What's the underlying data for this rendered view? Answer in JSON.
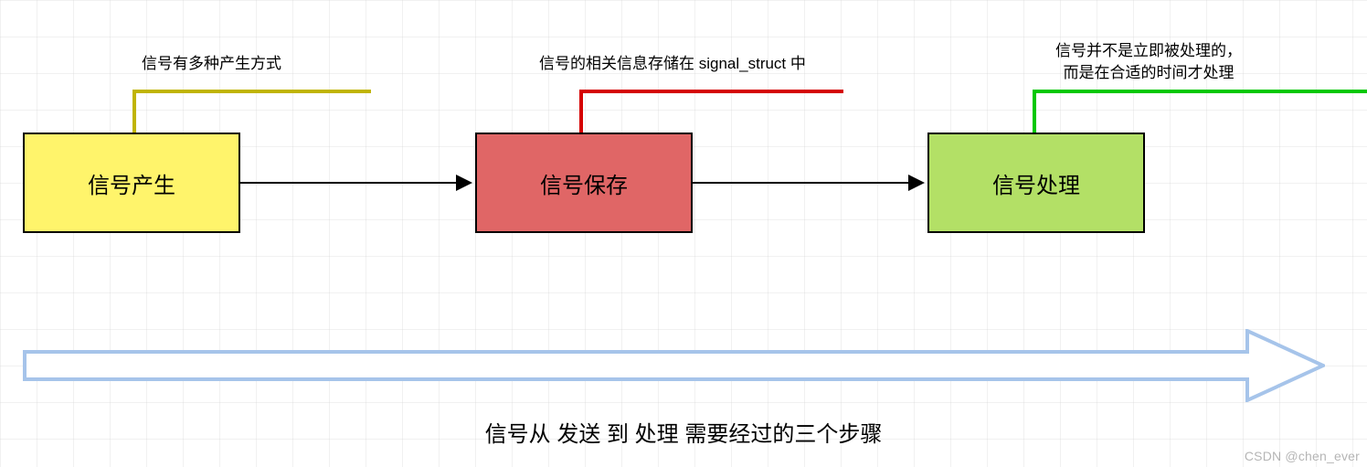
{
  "chart_data": {
    "type": "flow-diagram",
    "steps": [
      {
        "id": "generate",
        "label": "信号产生",
        "fill": "#fff46b",
        "stroke": "#000000",
        "annotation": "信号有多种产生方式",
        "annotation_color": "#c0b400"
      },
      {
        "id": "store",
        "label": "信号保存",
        "fill": "#e06666",
        "stroke": "#000000",
        "annotation": "信号的相关信息存储在 signal_struct 中",
        "annotation_color": "#d50000"
      },
      {
        "id": "process",
        "label": "信号处理",
        "fill": "#b3e066",
        "stroke": "#000000",
        "annotation": "信号并不是立即被处理的，\n而是在合适的时间才处理",
        "annotation_color": "#00c800"
      }
    ],
    "edges": [
      {
        "from": "generate",
        "to": "store"
      },
      {
        "from": "store",
        "to": "process"
      }
    ],
    "timeline_arrow": {
      "direction": "right",
      "color": "#a6c4ea"
    },
    "caption": "信号从 发送 到 处理 需要经过的三个步骤"
  },
  "stages": {
    "generate_label": "信号产生",
    "store_label": "信号保存",
    "process_label": "信号处理"
  },
  "annotations": {
    "anno_generate": "信号有多种产生方式",
    "anno_store": "信号的相关信息存储在 signal_struct 中",
    "anno_process_l1": "信号并不是立即被处理的，",
    "anno_process_l2": "而是在合适的时间才处理"
  },
  "caption": "信号从 发送 到 处理 需要经过的三个步骤",
  "watermark": "CSDN @chen_ever"
}
